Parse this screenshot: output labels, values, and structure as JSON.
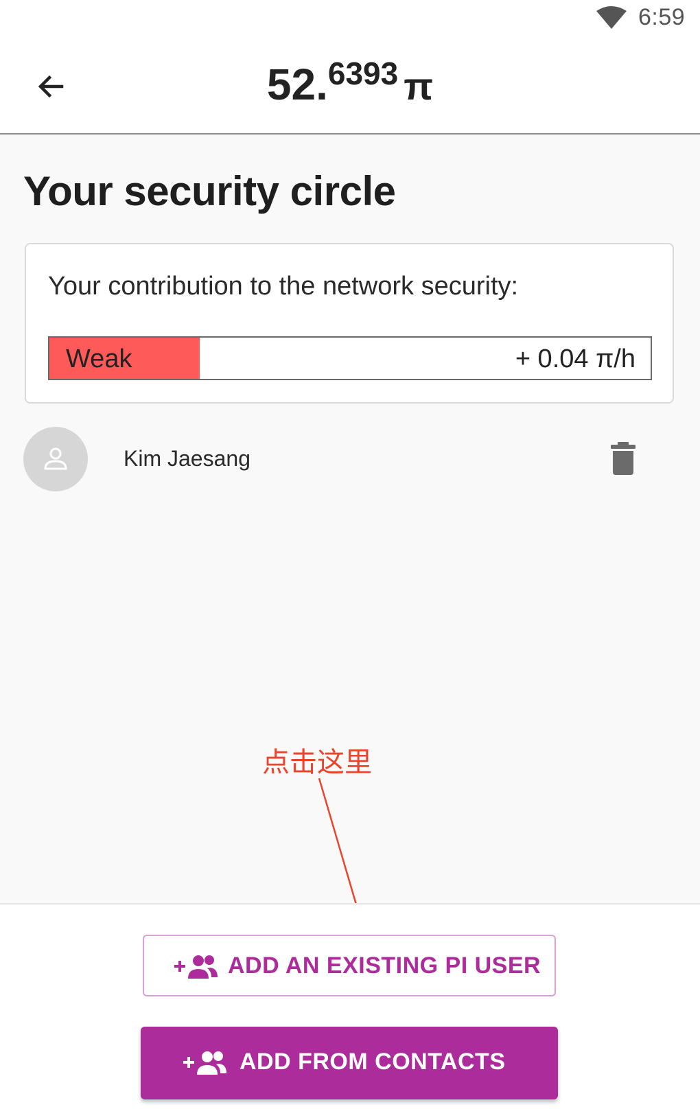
{
  "status_bar": {
    "time": "6:59",
    "wifi_icon": "wifi-icon"
  },
  "header": {
    "back_icon": "arrow-left-icon",
    "balance_integer": "52.",
    "balance_decimal": "6393",
    "currency_symbol": "π"
  },
  "page": {
    "title": "Your security circle"
  },
  "contribution_card": {
    "label": "Your contribution to the network security:",
    "level": "Weak",
    "rate": "+ 0.04 π/h",
    "fill_fraction": 0.25,
    "fill_color": "#ff5a5a"
  },
  "members": [
    {
      "name": "Kim Jaesang",
      "avatar_icon": "person-icon",
      "action_icon": "trash-icon"
    }
  ],
  "annotation": {
    "text": "点击这里",
    "color": "#e8452c"
  },
  "buttons": {
    "add_existing": {
      "label": "ADD AN EXISTING PI USER",
      "icon": "add-group-icon"
    },
    "add_contacts": {
      "label": "ADD FROM CONTACTS",
      "icon": "add-group-icon"
    }
  },
  "colors": {
    "accent": "#ac2c9b",
    "weak": "#ff5a5a",
    "annotation": "#e8452c"
  }
}
